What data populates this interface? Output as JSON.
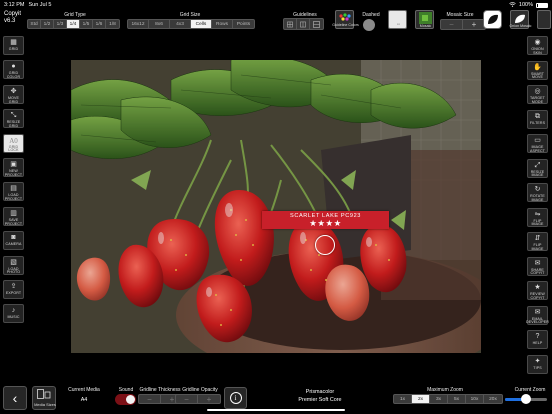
{
  "status": {
    "time": "3:12 PM",
    "date": "Sun Jul 5",
    "battery": "100%"
  },
  "app": {
    "title": "Copyit",
    "version": "v6.3"
  },
  "toolbar": {
    "grid_type_label": "Grid Type",
    "grid_type_options": [
      "Std",
      "1/2",
      "1/3",
      "1/4",
      "1/5",
      "1/6",
      "1/8"
    ],
    "grid_type_selected": "1/4",
    "grid_size_label": "Grid Size",
    "grid_size_options": [
      "16x12",
      "8x6",
      "4x3",
      "Cells",
      "Rows",
      "Points"
    ],
    "grid_size_selected": "Cells",
    "guidelines_label": "Guidelines",
    "dashed_label": "Dashed",
    "guideline_colors_label": "Guideline Colors",
    "mosaic_label": "Mosaic",
    "mosaic_size_label": "Mosaic Size",
    "mosaic_minus": "−",
    "mosaic_plus": "+",
    "toggle_label": "",
    "onion_mosaic_label": "Onion Mosaic"
  },
  "left_sidebar": [
    {
      "label": "Grid",
      "icon": "grid-icon"
    },
    {
      "label": "Grid Color",
      "icon": "palette-icon"
    },
    {
      "label": "Move Grid",
      "icon": "move-icon"
    },
    {
      "label": "Resize Grid",
      "icon": "resize-icon"
    },
    {
      "label": "Grid Lock",
      "icon": "text-icon"
    },
    {
      "label": "New Project",
      "icon": "image-icon"
    },
    {
      "label": "Load Project",
      "icon": "folder-icon"
    },
    {
      "label": "Save Project",
      "icon": "save-icon"
    },
    {
      "label": "Camera",
      "icon": "camera-icon"
    },
    {
      "label": "Load Photo",
      "icon": "photo-icon"
    },
    {
      "label": "Export",
      "icon": "share-icon"
    },
    {
      "label": "Music",
      "icon": "music-icon"
    }
  ],
  "right_sidebar": [
    {
      "label": "Onion Skin",
      "icon": "onion-icon"
    },
    {
      "label": "Smart Move",
      "icon": "hand-icon"
    },
    {
      "label": "Target Mode",
      "icon": "target-icon"
    },
    {
      "label": "Filters",
      "icon": "filter-icon"
    },
    {
      "label": "Image Aspect",
      "icon": "aspect-icon"
    },
    {
      "label": "Resize Image",
      "icon": "resize-image-icon"
    },
    {
      "label": "Rotate Image",
      "icon": "rotate-icon"
    },
    {
      "label": "Flip Image",
      "icon": "flip-horizontal-icon"
    },
    {
      "label": "Flip Image",
      "icon": "flip-vertical-icon"
    },
    {
      "label": "Share Copyit",
      "icon": "mail-icon"
    },
    {
      "label": "Review Copyit",
      "icon": "review-icon"
    },
    {
      "label": "Email Developer",
      "icon": "email-icon"
    },
    {
      "label": "Help",
      "icon": "help-icon"
    },
    {
      "label": "Tips",
      "icon": "lightbulb-icon"
    }
  ],
  "photo": {
    "color_name": "Scarlet Lake PC923",
    "stars": "★★★★"
  },
  "bottom": {
    "media_sizes_label": "Media Sizes",
    "current_media_label": "Current Media",
    "current_media_value": "A4",
    "sound_label": "Sound",
    "gridline_thickness_label": "Gridline Thickness",
    "gridline_opacity_label": "Gridline Opacity",
    "minus": "−",
    "plus": "+",
    "brand_line1": "Prismacolor",
    "brand_line2": "Premier Soft Core",
    "max_zoom_label": "Maximum Zoom",
    "zoom_options": [
      "1x",
      "2x",
      "3x",
      "5x",
      "10x",
      "20x"
    ],
    "zoom_selected": "2x",
    "current_zoom_label": "Current Zoom",
    "current_zoom_fraction": 0.5
  },
  "colors": {
    "banner_red": "#c8202a",
    "selected_segment": "#f2f2f2",
    "toggle_on": "#7c1016",
    "slider_blue": "#1e6fe0"
  }
}
